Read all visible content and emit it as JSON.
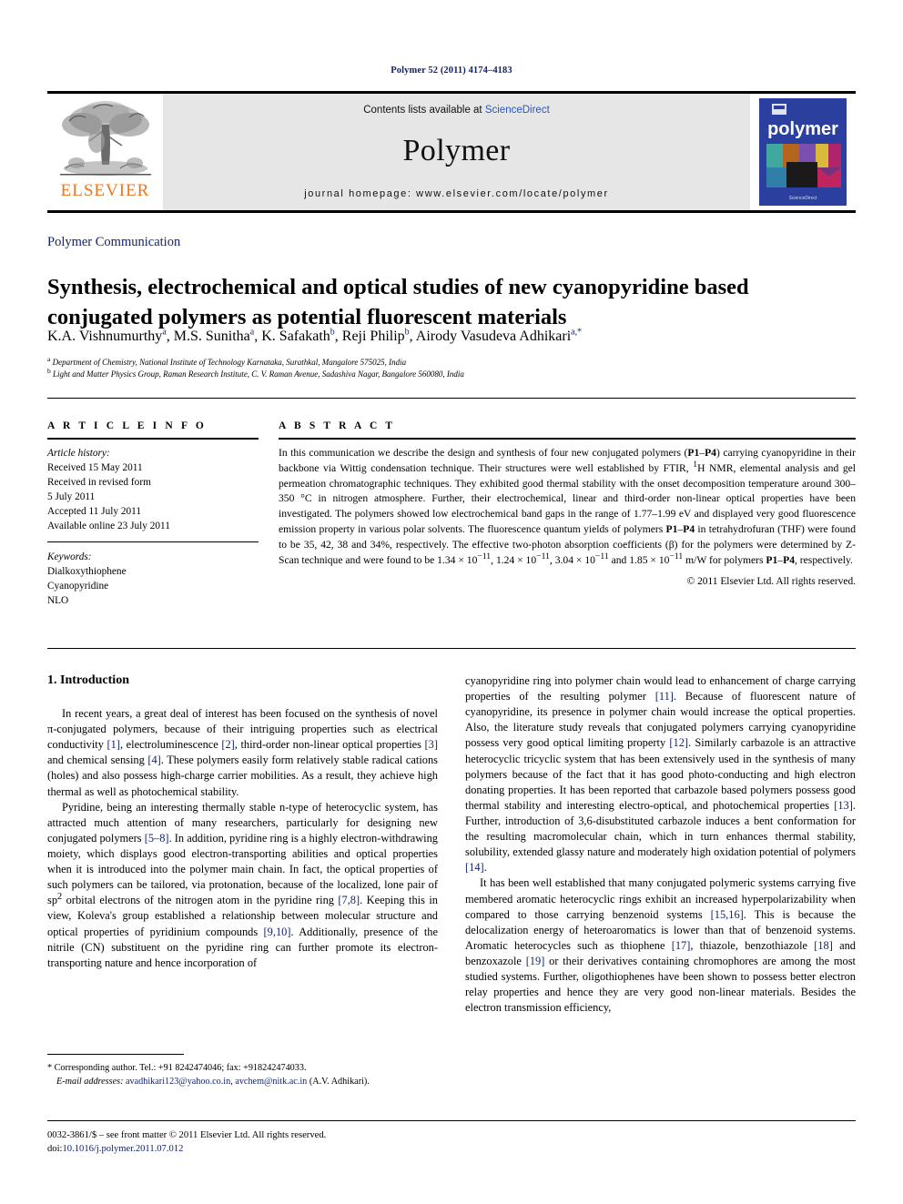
{
  "running_head": "Polymer 52 (2011) 4174–4183",
  "masthead": {
    "publisher_name": "ELSEVIER",
    "contents_prefix": "Contents lists available at ",
    "sciencedirect": "ScienceDirect",
    "journal_title": "Polymer",
    "homepage": "journal homepage: www.elsevier.com/locate/polymer",
    "cover_word": "polymer",
    "cover_footer": "ScienceDirect"
  },
  "article": {
    "section_type": "Polymer Communication",
    "title": "Synthesis, electrochemical and optical studies of new cyanopyridine based conjugated polymers as potential fluorescent materials",
    "authors_html": "K.A. Vishnumurthy<sup>a</sup>, M.S. Sunitha<sup>a</sup>, K. Safakath<sup>b</sup>, Reji Philip<sup>b</sup>, Airody Vasudeva Adhikari<sup>a,*</sup>",
    "affiliation_a": "Department of Chemistry, National Institute of Technology Karnataka, Surathkal, Mangalore 575025, India",
    "affiliation_b": "Light and Matter Physics Group, Raman Research Institute, C. V. Raman Avenue, Sadashiva Nagar, Bangalore 560080, India"
  },
  "article_info": {
    "heading": "A R T I C L E  I N F O",
    "history_label": "Article history:",
    "history": [
      "Received 15 May 2011",
      "Received in revised form",
      "5 July 2011",
      "Accepted 11 July 2011",
      "Available online 23 July 2011"
    ],
    "keywords_label": "Keywords:",
    "keywords": [
      "Dialkoxythiophene",
      "Cyanopyridine",
      "NLO"
    ]
  },
  "abstract": {
    "heading": "A B S T R A C T",
    "body_html": "In this communication we describe the design and synthesis of four new conjugated polymers (<b>P1</b>–<b>P4</b>) carrying cyanopyridine in their backbone via Wittig condensation technique. Their structures were well established by FTIR, <sup>1</sup>H NMR, elemental analysis and gel permeation chromatographic techniques. They exhibited good thermal stability with the onset decomposition temperature around 300–350 °C in nitrogen atmosphere. Further, their electrochemical, linear and third-order non-linear optical properties have been investigated. The polymers showed low electrochemical band gaps in the range of 1.77–1.99 eV and displayed very good fluorescence emission property in various polar solvents. The fluorescence quantum yields of polymers <b>P1</b>–<b>P4</b> in tetrahydrofuran (THF) were found to be 35, 42, 38 and 34%, respectively. The effective two-photon absorption coefficients (β) for the polymers were determined by Z-Scan technique and were found to be 1.34 × 10<sup>−11</sup>, 1.24 × 10<sup>−11</sup>, 3.04 × 10<sup>−11</sup> and 1.85 × 10<sup>−11</sup> m/W for polymers <b>P1</b>–<b>P4</b>, respectively.",
    "copyright": "© 2011 Elsevier Ltd. All rights reserved."
  },
  "intro": {
    "heading": "1. Introduction",
    "left_paragraphs_html": [
      "In recent years, a great deal of interest has been focused on the synthesis of novel π-conjugated polymers, because of their intriguing properties such as electrical conductivity <span class=\"ref\">[1]</span>, electroluminescence <span class=\"ref\">[2]</span>, third-order non-linear optical properties <span class=\"ref\">[3]</span> and chemical sensing <span class=\"ref\">[4]</span>. These polymers easily form relatively stable radical cations (holes) and also possess high-charge carrier mobilities. As a result, they achieve high thermal as well as photochemical stability.",
      "Pyridine, being an interesting thermally stable n-type of heterocyclic system, has attracted much attention of many researchers, particularly for designing new conjugated polymers <span class=\"ref\">[5–8]</span>. In addition, pyridine ring is a highly electron-withdrawing moiety, which displays good electron-transporting abilities and optical properties when it is introduced into the polymer main chain. In fact, the optical properties of such polymers can be tailored, via protonation, because of the localized, lone pair of sp<sup>2</sup> orbital electrons of the nitrogen atom in the pyridine ring <span class=\"ref\">[7,8]</span>. Keeping this in view, Koleva's group established a relationship between molecular structure and optical properties of pyridinium compounds <span class=\"ref\">[9,10]</span>. Additionally, presence of the nitrile (CN) substituent on the pyridine ring can further promote its electron-transporting nature and hence incorporation of"
    ],
    "right_paragraphs_html": [
      "cyanopyridine ring into polymer chain would lead to enhancement of charge carrying properties of the resulting polymer <span class=\"ref\">[11]</span>. Because of fluorescent nature of cyanopyridine, its presence in polymer chain would increase the optical properties. Also, the literature study reveals that conjugated polymers carrying cyanopyridine possess very good optical limiting property <span class=\"ref\">[12]</span>. Similarly carbazole is an attractive heterocyclic tricyclic system that has been extensively used in the synthesis of many polymers because of the fact that it has good photo-conducting and high electron donating properties. It has been reported that carbazole based polymers possess good thermal stability and interesting electro-optical, and photochemical properties <span class=\"ref\">[13]</span>. Further, introduction of 3,6-disubstituted carbazole induces a bent conformation for the resulting macromolecular chain, which in turn enhances thermal stability, solubility, extended glassy nature and moderately high oxidation potential of polymers <span class=\"ref\">[14]</span>.",
      "It has been well established that many conjugated polymeric systems carrying five membered aromatic heterocyclic rings exhibit an increased hyperpolarizability when compared to those carrying benzenoid systems <span class=\"ref\">[15,16]</span>. This is because the delocalization energy of heteroaromatics is lower than that of benzenoid systems. Aromatic heterocycles such as thiophene <span class=\"ref\">[17]</span>, thiazole, benzothiazole <span class=\"ref\">[18]</span> and benzoxazole <span class=\"ref\">[19]</span> or their derivatives containing chromophores are among the most studied systems. Further, oligothiophenes have been shown to possess better electron relay properties and hence they are very good non-linear materials. Besides the electron transmission efficiency,"
    ]
  },
  "footnote": {
    "corresponding_html": "* Corresponding author. Tel.: +91 8242474046; fax: +918242474033.",
    "email_html": "<span class=\"lbl\">E-mail addresses:</span> <span class=\"mail\">avadhikari123@yahoo.co.in</span>, <span class=\"mail\">avchem@nitk.ac.in</span> (A.V. Adhikari)."
  },
  "colophon": {
    "issn_line": "0032-3861/$ – see front matter © 2011 Elsevier Ltd. All rights reserved.",
    "doi_prefix": "doi:",
    "doi": "10.1016/j.polymer.2011.07.012"
  },
  "colors": {
    "elsevier_orange": "#E87722",
    "link_blue": "#2b56b5",
    "ref_navy": "#14236b",
    "masthead_grey": "#e6e6e6",
    "cover_blue": "#2b3f9e"
  }
}
